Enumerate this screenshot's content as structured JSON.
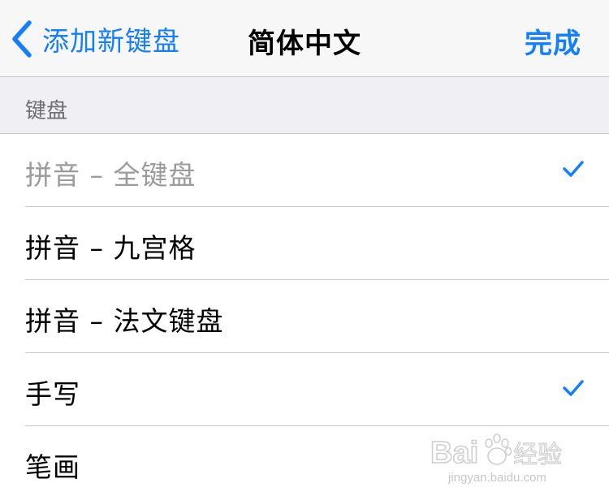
{
  "navbar": {
    "back_label": "添加新键盘",
    "title": "简体中文",
    "done_label": "完成"
  },
  "section": {
    "header": "键盘"
  },
  "keyboards": [
    {
      "label": "拼音 – 全键盘",
      "checked": true,
      "disabled": true
    },
    {
      "label": "拼音 – 九宫格",
      "checked": false,
      "disabled": false
    },
    {
      "label": "拼音 – 法文键盘",
      "checked": false,
      "disabled": false
    },
    {
      "label": "手写",
      "checked": true,
      "disabled": false
    },
    {
      "label": "笔画",
      "checked": false,
      "disabled": false
    }
  ],
  "watermark": {
    "logo_text": "Bai 经验",
    "url_text": "jingyan.baidu.com"
  },
  "colors": {
    "accent": "#147efb",
    "navbar_bg": "#f7f7f7",
    "section_bg": "#efeff4",
    "separator": "#c8c7cc",
    "disabled_text": "#9b9b9b"
  },
  "icons": {
    "back": "chevron-left-icon",
    "check": "checkmark-icon",
    "watermark": "baidu-paw-logo"
  }
}
